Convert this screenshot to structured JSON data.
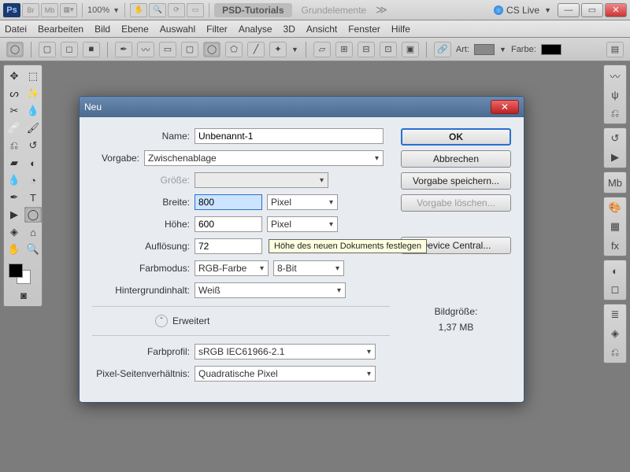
{
  "topbar": {
    "zoom": "100%",
    "tab_active": "PSD-Tutorials",
    "tab_inactive": "Grundelemente",
    "cslive": "CS Live"
  },
  "menu": [
    "Datei",
    "Bearbeiten",
    "Bild",
    "Ebene",
    "Auswahl",
    "Filter",
    "Analyse",
    "3D",
    "Ansicht",
    "Fenster",
    "Hilfe"
  ],
  "options": {
    "art": "Art:",
    "farbe": "Farbe:"
  },
  "dialog": {
    "title": "Neu",
    "name_lbl": "Name:",
    "name_val": "Unbenannt-1",
    "preset_lbl": "Vorgabe:",
    "preset_val": "Zwischenablage",
    "size_lbl": "Größe:",
    "width_lbl": "Breite:",
    "width_val": "800",
    "width_unit": "Pixel",
    "height_lbl": "Höhe:",
    "height_val": "600",
    "height_unit": "Pixel",
    "res_lbl": "Auflösung:",
    "res_val": "72",
    "mode_lbl": "Farbmodus:",
    "mode_val": "RGB-Farbe",
    "depth_val": "8-Bit",
    "bg_lbl": "Hintergrundinhalt:",
    "bg_val": "Weiß",
    "adv": "Erweitert",
    "profile_lbl": "Farbprofil:",
    "profile_val": "sRGB IEC61966-2.1",
    "aspect_lbl": "Pixel-Seitenverhältnis:",
    "aspect_val": "Quadratische Pixel",
    "ok": "OK",
    "cancel": "Abbrechen",
    "save_preset": "Vorgabe speichern...",
    "del_preset": "Vorgabe löschen...",
    "device": "Device Central...",
    "filesize_lbl": "Bildgröße:",
    "filesize_val": "1,37 MB",
    "tooltip": "Höhe des neuen Dokuments festlegen"
  }
}
